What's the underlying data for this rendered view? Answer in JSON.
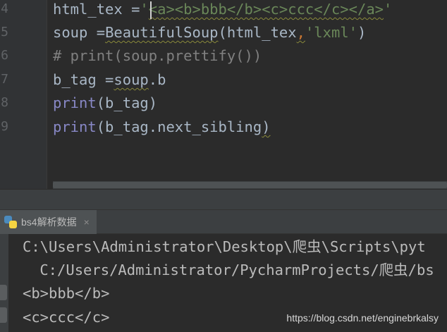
{
  "editor": {
    "line_numbers": [
      "4",
      "5",
      "6",
      "7",
      "8",
      "9"
    ],
    "lines": [
      {
        "parts": [
          {
            "text": "html_tex =",
            "cls": ""
          },
          {
            "text": "'",
            "cls": "tok-str"
          },
          {
            "text": "<a><b>bbb</b><c>ccc</c></a>",
            "cls": "tok-str squiggle"
          },
          {
            "text": "'",
            "cls": "tok-str"
          }
        ]
      },
      {
        "parts": [
          {
            "text": "soup =",
            "cls": ""
          },
          {
            "text": "BeautifulSoup",
            "cls": "squiggle"
          },
          {
            "text": "(html_tex",
            "cls": ""
          },
          {
            "text": ",",
            "cls": "tok-punct squiggle"
          },
          {
            "text": "'lxml'",
            "cls": "tok-str"
          },
          {
            "text": ")",
            "cls": ""
          }
        ]
      },
      {
        "parts": [
          {
            "text": "# print(soup.prettify())",
            "cls": "tok-comment"
          }
        ]
      },
      {
        "parts": [
          {
            "text": "b_tag =",
            "cls": ""
          },
          {
            "text": "soup",
            "cls": "squiggle"
          },
          {
            "text": ".b",
            "cls": ""
          }
        ]
      },
      {
        "parts": [
          {
            "text": "print",
            "cls": "tok-fn"
          },
          {
            "text": "(b_tag)",
            "cls": ""
          }
        ]
      },
      {
        "parts": [
          {
            "text": "print",
            "cls": "tok-fn"
          },
          {
            "text": "(b_tag.next_sibling",
            "cls": ""
          },
          {
            "text": ")",
            "cls": "squiggle"
          }
        ]
      }
    ]
  },
  "run_panel": {
    "tab_label": "bs4解析数据",
    "close_glyph": "×"
  },
  "console": {
    "lines": [
      "C:\\Users\\Administrator\\Desktop\\爬虫\\Scripts\\pyt",
      " C:/Users/Administrator/PycharmProjects/爬虫/bs",
      "<b>bbb</b>",
      "<c>ccc</c>"
    ]
  },
  "watermark": "https://blog.csdn.net/enginebrkalsy",
  "colors": {
    "background": "#2b2b2b",
    "string": "#6a8759",
    "comment": "#808080",
    "builtin": "#8888c6",
    "text": "#a9b7c6"
  }
}
